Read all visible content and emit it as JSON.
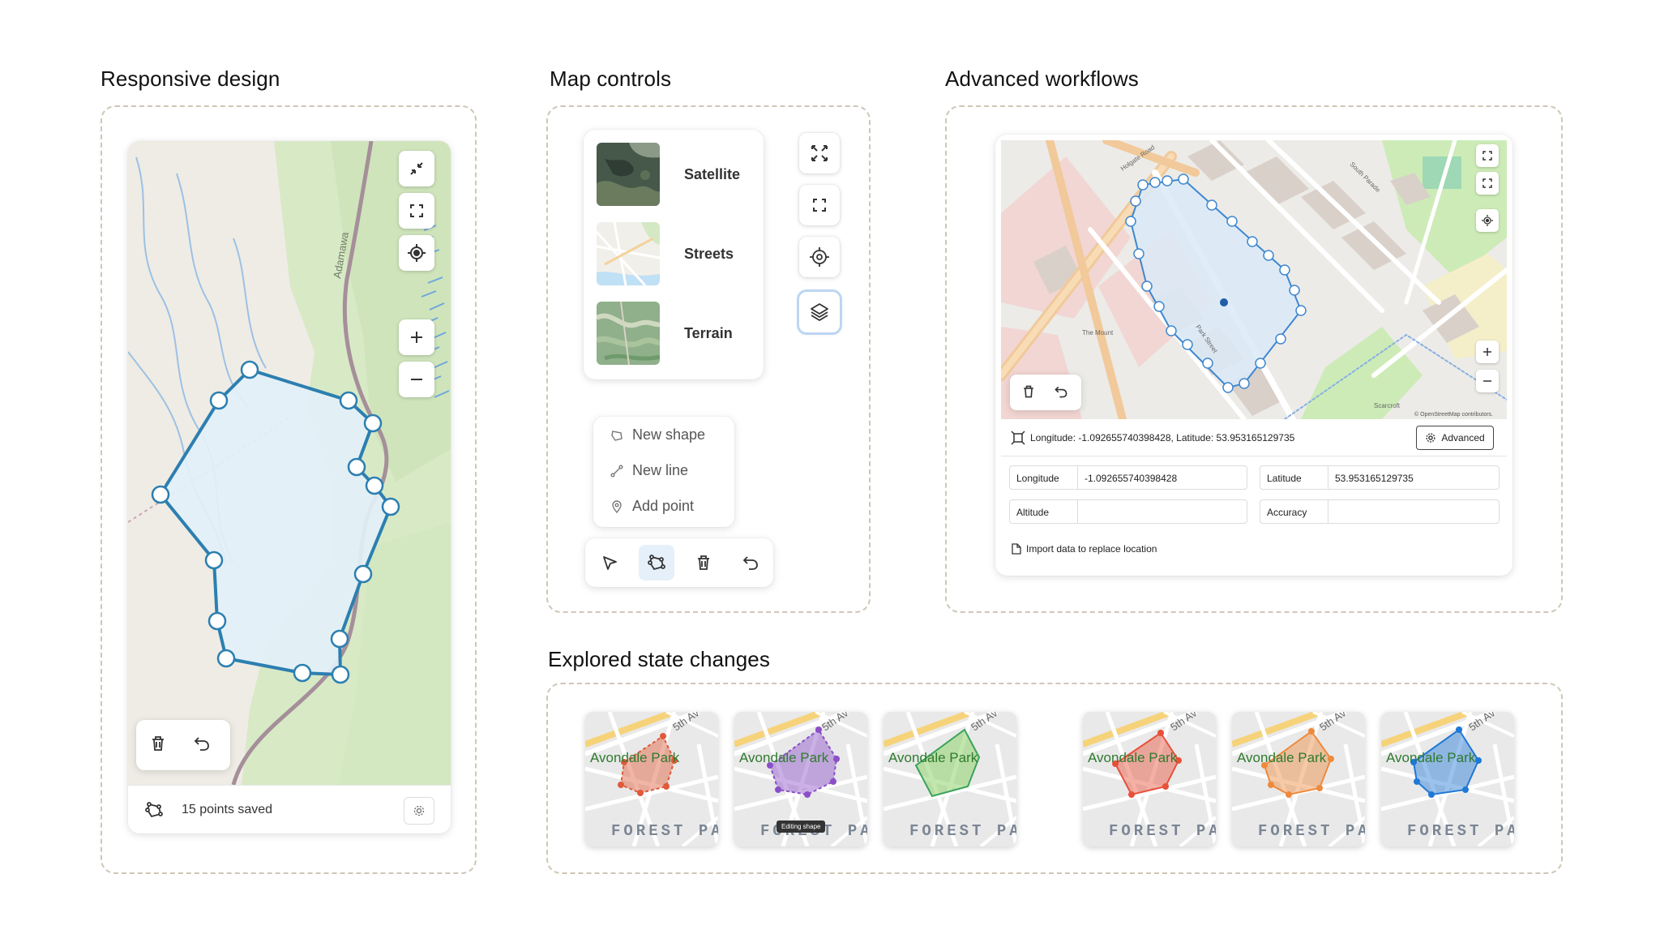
{
  "sections": {
    "responsive": "Responsive design",
    "controls": "Map controls",
    "advanced": "Advanced workflows",
    "states": "Explored state changes"
  },
  "responsive_map": {
    "river_label": "Adamawa",
    "status_text": "15 points saved",
    "buttons": [
      "collapse",
      "fullscreen",
      "locate",
      "zoom-in",
      "zoom-out",
      "delete",
      "undo",
      "settings"
    ]
  },
  "map_controls": {
    "layers": [
      {
        "label": "Satellite"
      },
      {
        "label": "Streets"
      },
      {
        "label": "Terrain"
      }
    ],
    "menu": [
      {
        "label": "New shape",
        "icon": "shape-icon"
      },
      {
        "label": "New line",
        "icon": "line-icon"
      },
      {
        "label": "Add point",
        "icon": "pin-icon"
      }
    ],
    "toolbar": [
      "select",
      "draw-shape",
      "delete",
      "undo"
    ],
    "toolbar_active": "draw-shape"
  },
  "advanced": {
    "coordinate_text": "Longitude: -1.092655740398428, Latitude: 53.953165129735",
    "advanced_button": "Advanced",
    "fields": [
      {
        "label": "Longitude",
        "value": "-1.092655740398428"
      },
      {
        "label": "Latitude",
        "value": "53.953165129735"
      },
      {
        "label": "Altitude",
        "value": ""
      },
      {
        "label": "Accuracy",
        "value": ""
      }
    ],
    "import_text": "Import data to replace location",
    "attribution": "© OpenStreetMap contributors.",
    "map_labels": [
      "Holgate Road",
      "The Mount",
      "Park Street",
      "South Parade",
      "Scarcroft"
    ]
  },
  "states": {
    "park_label": "Avondale Park",
    "district_label": "FOREST PA",
    "street_label": "5th Av",
    "tooltip": "Editing shape",
    "thumbnails": [
      {
        "state": "invalid-outline",
        "color": "#e05a3a"
      },
      {
        "state": "editing",
        "color": "#8a4fc8"
      },
      {
        "state": "complete",
        "color": "#3aa35a"
      },
      {
        "state": "invalid",
        "color": "#e8503a"
      },
      {
        "state": "warning",
        "color": "#ee8a3c"
      },
      {
        "state": "selected",
        "color": "#1e78d7"
      }
    ]
  },
  "colors": {
    "polygon_stroke": "#2c7fb0",
    "polygon_fill": "#e3f0f9",
    "dashed_border": "#cfc6b6",
    "active_tool_bg": "#e6f0fa"
  }
}
